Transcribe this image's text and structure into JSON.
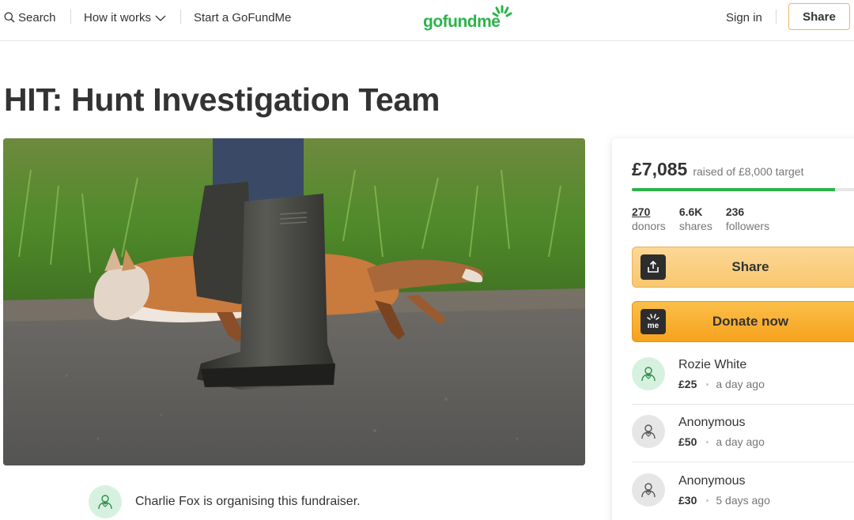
{
  "nav": {
    "search_label": "Search",
    "how_it_works_label": "How it works",
    "start_label": "Start a GoFundMe",
    "logo_text": "gofundme",
    "sign_in_label": "Sign in",
    "share_label": "Share"
  },
  "campaign": {
    "title": "HIT: Hunt Investigation Team",
    "organiser_text": "Charlie Fox is organising this fundraiser."
  },
  "panel": {
    "raised_amount": "£7,085",
    "raised_target": "raised of £8,000 target",
    "progress_fraction": 0.886,
    "stats": [
      {
        "value": "270",
        "label": "donors"
      },
      {
        "value": "6.6K",
        "label": "shares"
      },
      {
        "value": "236",
        "label": "followers"
      }
    ],
    "share_button_label": "Share",
    "donate_button_label": "Donate now",
    "donate_icon_text": "me",
    "donations": [
      {
        "name": "Rozie White",
        "amount": "£25",
        "time": "a day ago",
        "avatar": "green"
      },
      {
        "name": "Anonymous",
        "amount": "£50",
        "time": "a day ago",
        "avatar": "grey"
      },
      {
        "name": "Anonymous",
        "amount": "£30",
        "time": "5 days ago",
        "avatar": "grey"
      }
    ]
  },
  "colors": {
    "brand_green": "#2cb34a",
    "share_button": "#f9c76f",
    "donate_button": "#f6a21d"
  }
}
